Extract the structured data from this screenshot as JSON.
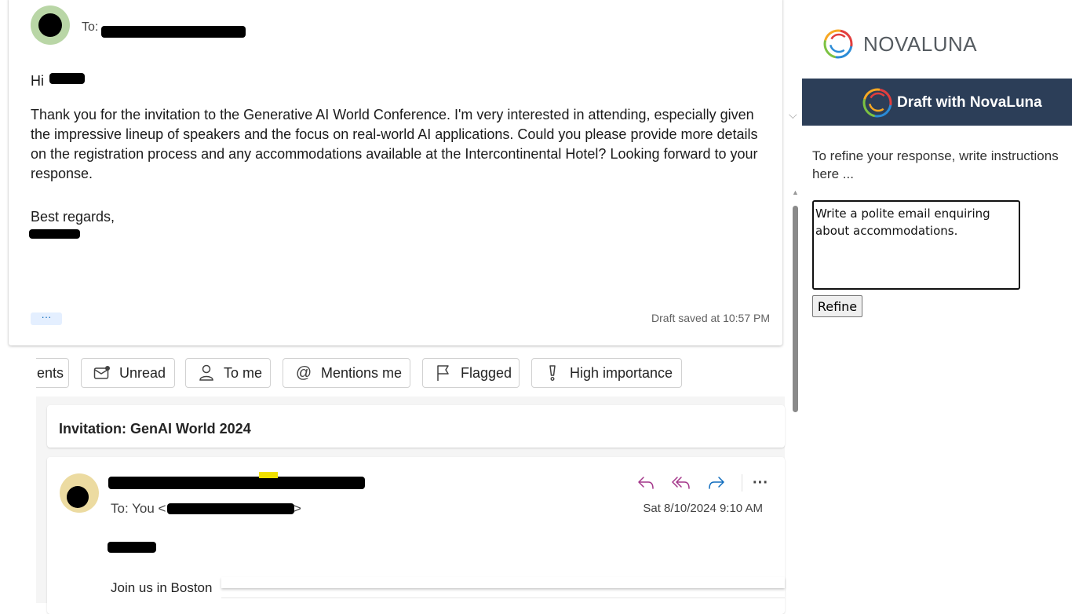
{
  "compose": {
    "to_label": "To:",
    "greeting": "Hi",
    "paragraph": "Thank you for the invitation to the Generative AI World Conference. I'm very interested in attending, especially given the impressive lineup of speakers and the focus on real-world AI applications. Could you please provide more details on the registration process and any accommodations available at the Intercontinental Hotel? Looking forward to your response.",
    "closing": "Best regards,",
    "more_label": "···",
    "draft_status": "Draft saved at 10:57 PM"
  },
  "filters": [
    {
      "label": "ents",
      "icon": "none"
    },
    {
      "label": "Unread",
      "icon": "mail-unread-icon"
    },
    {
      "label": "To me",
      "icon": "person-icon"
    },
    {
      "label": "Mentions me",
      "icon": "at-icon"
    },
    {
      "label": "Flagged",
      "icon": "flag-icon"
    },
    {
      "label": "High importance",
      "icon": "importance-icon"
    }
  ],
  "message": {
    "subject": "Invitation: GenAI World 2024",
    "to_label": "To:  You <",
    "to_suffix": ">",
    "date": "Sat 8/10/2024 9:10 AM",
    "body_start": "Join us in Boston",
    "more_actions_label": "···"
  },
  "panel": {
    "brand": "NOVALUNA",
    "header_title": "Draft with NovaLuna",
    "instructions": "To refine your response, write instructions here ...",
    "textarea_value": "Write a polite email enquiring about accommodations.",
    "refine_label": "Refine"
  },
  "colors": {
    "header_bar": "#2c3e58",
    "reply_icons": "#a4378a",
    "forward_icon": "#0f6cbd"
  }
}
